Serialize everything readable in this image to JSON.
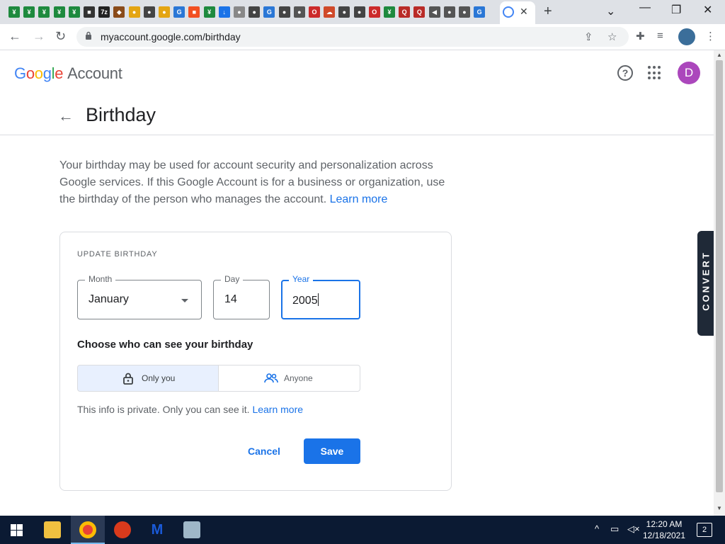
{
  "browser": {
    "tab_favicons": [
      {
        "icon": "grammarly-icon",
        "color": "#1e8a3e",
        "glyph": "¥"
      },
      {
        "icon": "grammarly-icon",
        "color": "#1e8a3e",
        "glyph": "¥"
      },
      {
        "icon": "grammarly-icon",
        "color": "#1e8a3e",
        "glyph": "¥"
      },
      {
        "icon": "grammarly-icon",
        "color": "#1e8a3e",
        "glyph": "¥"
      },
      {
        "icon": "grammarly-icon",
        "color": "#1e8a3e",
        "glyph": "¥"
      },
      {
        "icon": "square-app-icon",
        "color": "#333333",
        "glyph": "■"
      },
      {
        "icon": "7zip-icon",
        "color": "#222222",
        "glyph": "7z"
      },
      {
        "icon": "creature-icon",
        "color": "#8a4b1a",
        "glyph": "◆"
      },
      {
        "icon": "chrome-icon",
        "color": "#e4a512",
        "glyph": "●"
      },
      {
        "icon": "github-icon",
        "color": "#444444",
        "glyph": "●"
      },
      {
        "icon": "chrome-icon",
        "color": "#e4a512",
        "glyph": "●"
      },
      {
        "icon": "google-icon",
        "color": "#2a77d6",
        "glyph": "G"
      },
      {
        "icon": "microsoft-icon",
        "color": "#f25022",
        "glyph": "■"
      },
      {
        "icon": "grammarly-icon",
        "color": "#1e8a3e",
        "glyph": "¥"
      },
      {
        "icon": "download-icon",
        "color": "#1a73e8",
        "glyph": "↓"
      },
      {
        "icon": "apple-icon",
        "color": "#888888",
        "glyph": "●"
      },
      {
        "icon": "github-icon",
        "color": "#444444",
        "glyph": "●"
      },
      {
        "icon": "google-icon",
        "color": "#2a77d6",
        "glyph": "G"
      },
      {
        "icon": "github-icon",
        "color": "#444444",
        "glyph": "●"
      },
      {
        "icon": "globe-icon",
        "color": "#555555",
        "glyph": "●"
      },
      {
        "icon": "opera-icon",
        "color": "#cc2a2a",
        "glyph": "O"
      },
      {
        "icon": "cloud-icon",
        "color": "#d04a2a",
        "glyph": "☁"
      },
      {
        "icon": "github-icon",
        "color": "#444444",
        "glyph": "●"
      },
      {
        "icon": "github-icon",
        "color": "#444444",
        "glyph": "●"
      },
      {
        "icon": "opera-icon",
        "color": "#cc2a2a",
        "glyph": "O"
      },
      {
        "icon": "grammarly-icon",
        "color": "#1e8a3e",
        "glyph": "¥"
      },
      {
        "icon": "quora-icon",
        "color": "#b92b27",
        "glyph": "Q"
      },
      {
        "icon": "quora-icon",
        "color": "#b92b27",
        "glyph": "Q"
      },
      {
        "icon": "speaker-icon",
        "color": "#555555",
        "glyph": "◀"
      },
      {
        "icon": "globe-icon",
        "color": "#555555",
        "glyph": "●"
      },
      {
        "icon": "globe-icon",
        "color": "#555555",
        "glyph": "●"
      },
      {
        "icon": "google-icon",
        "color": "#2a77d6",
        "glyph": "G"
      }
    ],
    "active_tab_close": "✕",
    "new_tab": "+",
    "url": "myaccount.google.com/birthday"
  },
  "header": {
    "logo_letters": [
      "G",
      "o",
      "o",
      "g",
      "l",
      "e"
    ],
    "logo_suffix": "Account",
    "help_glyph": "?",
    "avatar_letter": "D"
  },
  "page": {
    "title": "Birthday",
    "description_text": "Your birthday may be used for account security and personalization across Google services. If this Google Account is for a business or organization, use the birthday of the person who manages the account. ",
    "description_link": "Learn more"
  },
  "form": {
    "section_label": "UPDATE BIRTHDAY",
    "month": {
      "label": "Month",
      "value": "January"
    },
    "day": {
      "label": "Day",
      "value": "14"
    },
    "year": {
      "label": "Year",
      "value": "2005"
    },
    "visibility_title": "Choose who can see your birthday",
    "visibility_options": [
      {
        "label": "Only you",
        "icon": "lock-icon",
        "selected": true
      },
      {
        "label": "Anyone",
        "icon": "people-icon",
        "selected": false
      }
    ],
    "private_note": "This info is private. Only you can see it. ",
    "private_link": "Learn more",
    "cancel_label": "Cancel",
    "save_label": "Save"
  },
  "extension_tab": {
    "label": "CONVERT"
  },
  "taskbar": {
    "time": "12:20 AM",
    "date": "12/18/2021",
    "notification_count": "2"
  },
  "colors": {
    "accent": "#1a73e8",
    "avatar": "#ab47bc",
    "selected_option_bg": "#e8f0fe"
  }
}
